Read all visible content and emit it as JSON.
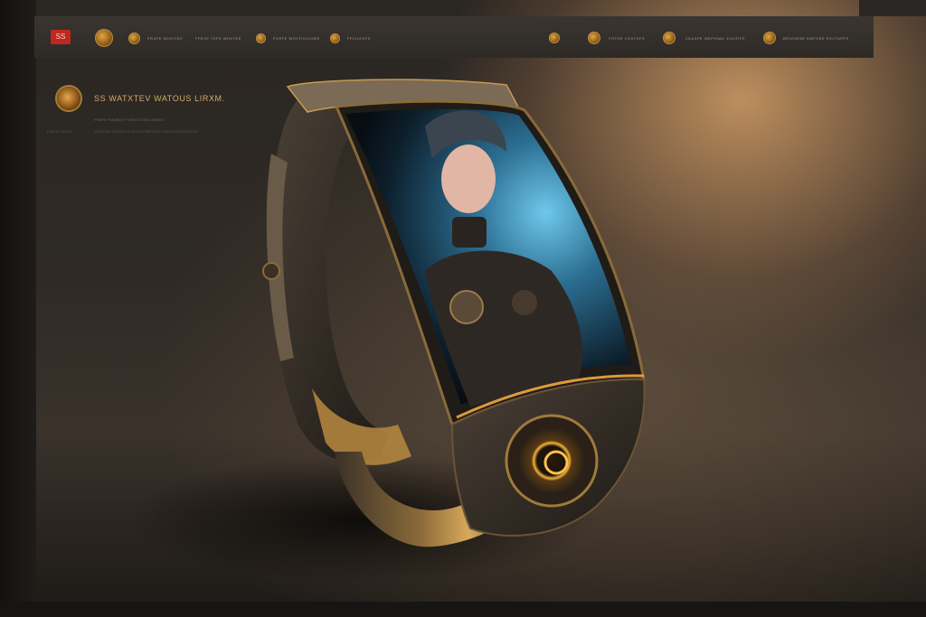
{
  "app": {
    "logo_text": "SS"
  },
  "topbar": {
    "left_items": [
      {
        "label": "",
        "icon": "emblem-icon"
      },
      {
        "label": "FRXPE WHXTIEV",
        "icon": "medallion-icon"
      },
      {
        "label": "FFEYE TVFE WHXTEE",
        "icon": ""
      },
      {
        "label": "PXRFE WHXTIVIVOWS",
        "icon": "medallion-icon"
      },
      {
        "label": "FFIVLEXFS",
        "icon": "medallion-icon"
      }
    ],
    "right_items": [
      {
        "label": "",
        "icon": "medallion-icon"
      },
      {
        "label": "FOTHE VOXTHFS",
        "icon": "medallion-icon"
      },
      {
        "label": "CEASPE WEPHNAL EXUTIFS",
        "icon": "medallion-icon"
      },
      {
        "label": "BRIVOESE EMFORE RXVTAPFS",
        "icon": "medallion-icon"
      }
    ]
  },
  "hero": {
    "title": "SS WATXTEV WATOUS LIRXM.",
    "subtitle": "FHEPE FHEAMTVF WFS EVTAS XAREES",
    "meta": "FXROX VIXOZ",
    "meta2": "TURTOW VSIXOLZ ZVIX EVFTREHALS FXZEEZ EWIROVSZS"
  },
  "colors": {
    "accent_gold": "#d1ad6b",
    "brand_red": "#c0281f",
    "screen_glow": "#3fa9d6"
  }
}
